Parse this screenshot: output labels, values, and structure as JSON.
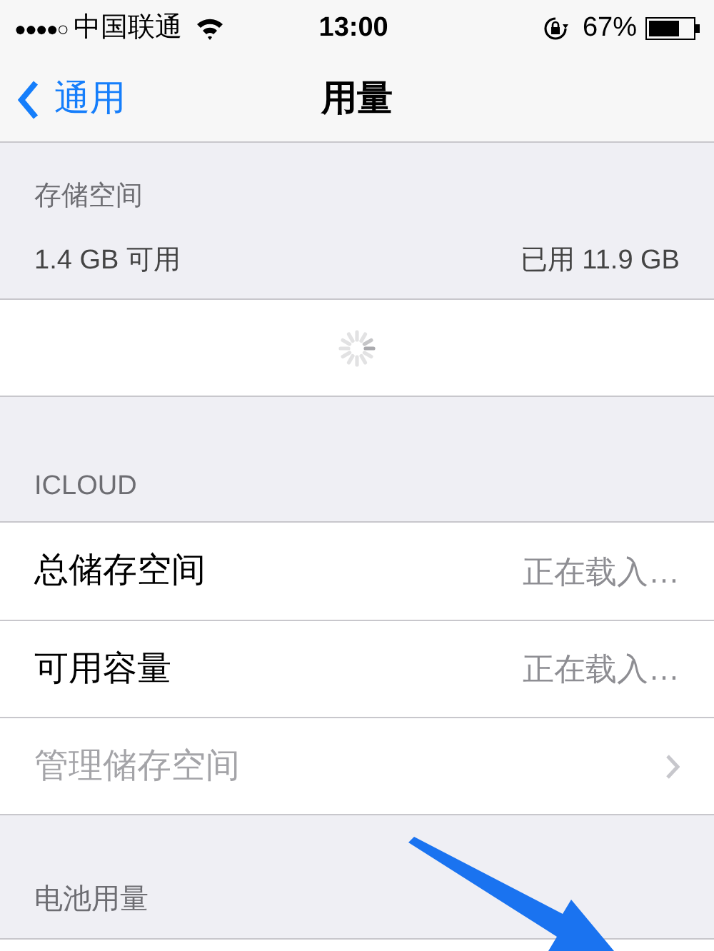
{
  "status_bar": {
    "signal_dots": "●●●●○",
    "carrier": "中国联通",
    "time": "13:00",
    "battery": "67%"
  },
  "nav": {
    "back": "通用",
    "title": "用量"
  },
  "storage": {
    "header": "存储空间",
    "available": "1.4 GB 可用",
    "used": "已用 11.9 GB",
    "loading": true
  },
  "icloud": {
    "header": "ICLOUD",
    "rows": [
      {
        "label": "总储存空间",
        "value": "正在载入…",
        "disabled": false
      },
      {
        "label": "可用容量",
        "value": "正在载入…",
        "disabled": false
      },
      {
        "label": "管理储存空间",
        "disabled": true
      }
    ]
  },
  "battery_section": {
    "header": "电池用量"
  }
}
